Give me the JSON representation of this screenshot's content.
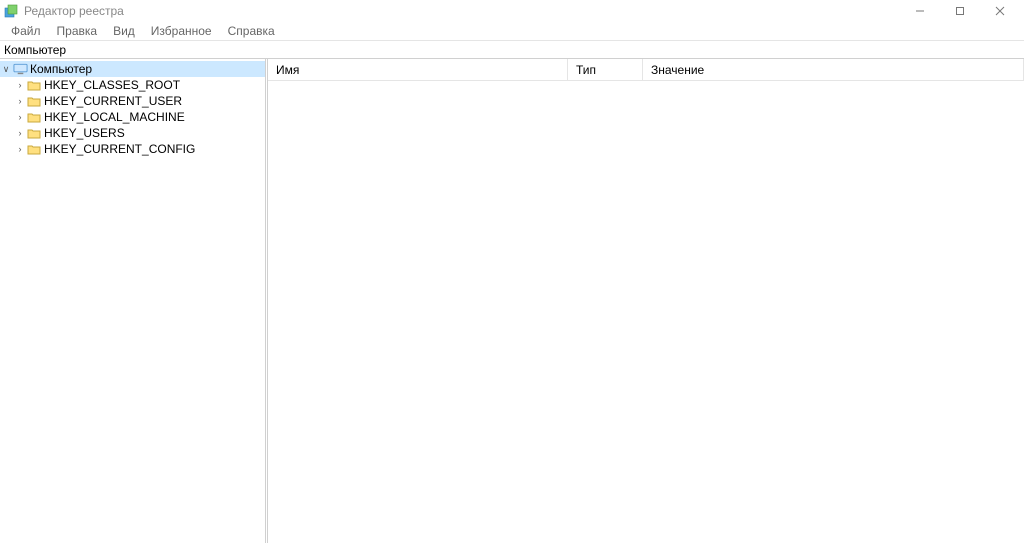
{
  "window": {
    "title": "Редактор реестра"
  },
  "menu": {
    "items": [
      "Файл",
      "Правка",
      "Вид",
      "Избранное",
      "Справка"
    ]
  },
  "address": {
    "value": "Компьютер"
  },
  "tree": {
    "root": {
      "label": "Компьютер",
      "expanded": true,
      "selected": true
    },
    "hives": [
      {
        "label": "HKEY_CLASSES_ROOT"
      },
      {
        "label": "HKEY_CURRENT_USER"
      },
      {
        "label": "HKEY_LOCAL_MACHINE"
      },
      {
        "label": "HKEY_USERS"
      },
      {
        "label": "HKEY_CURRENT_CONFIG"
      }
    ]
  },
  "list": {
    "columns": {
      "name": "Имя",
      "type": "Тип",
      "value": "Значение"
    },
    "rows": []
  }
}
